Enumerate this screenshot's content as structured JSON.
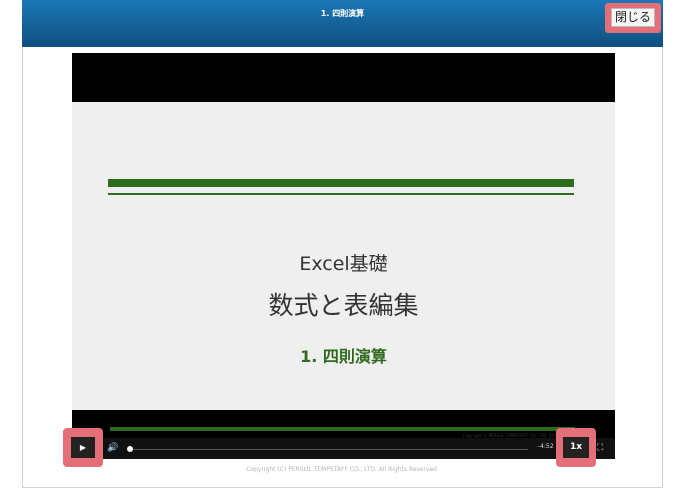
{
  "header": {
    "title": "1. 四則演算",
    "close_label": "閉じる"
  },
  "slide": {
    "line1": "Excel基礎",
    "line2": "数式と表編集",
    "subtitle": "1. 四則演算",
    "copyright": "Copyright © PERSOL TEMPSTAFF CO., LTD. All Rights Reserved."
  },
  "player": {
    "play_icon": "play-icon",
    "play_glyph": "▶",
    "volume_icon": "volume-icon",
    "volume_glyph": "🔊",
    "progress_fraction": 0.0,
    "time_remaining": "-4:52",
    "rate_label": "1x",
    "fullscreen_icon": "fullscreen-icon",
    "fullscreen_glyph": "⛶"
  },
  "footer": {
    "copyright": "Copyright (C) PERSOL TEMPSTAFF CO., LTD. All Rights Reserved."
  },
  "colors": {
    "header_blue": "#145f96",
    "highlight": "#e46f79",
    "slide_green": "#2f6b1f"
  }
}
